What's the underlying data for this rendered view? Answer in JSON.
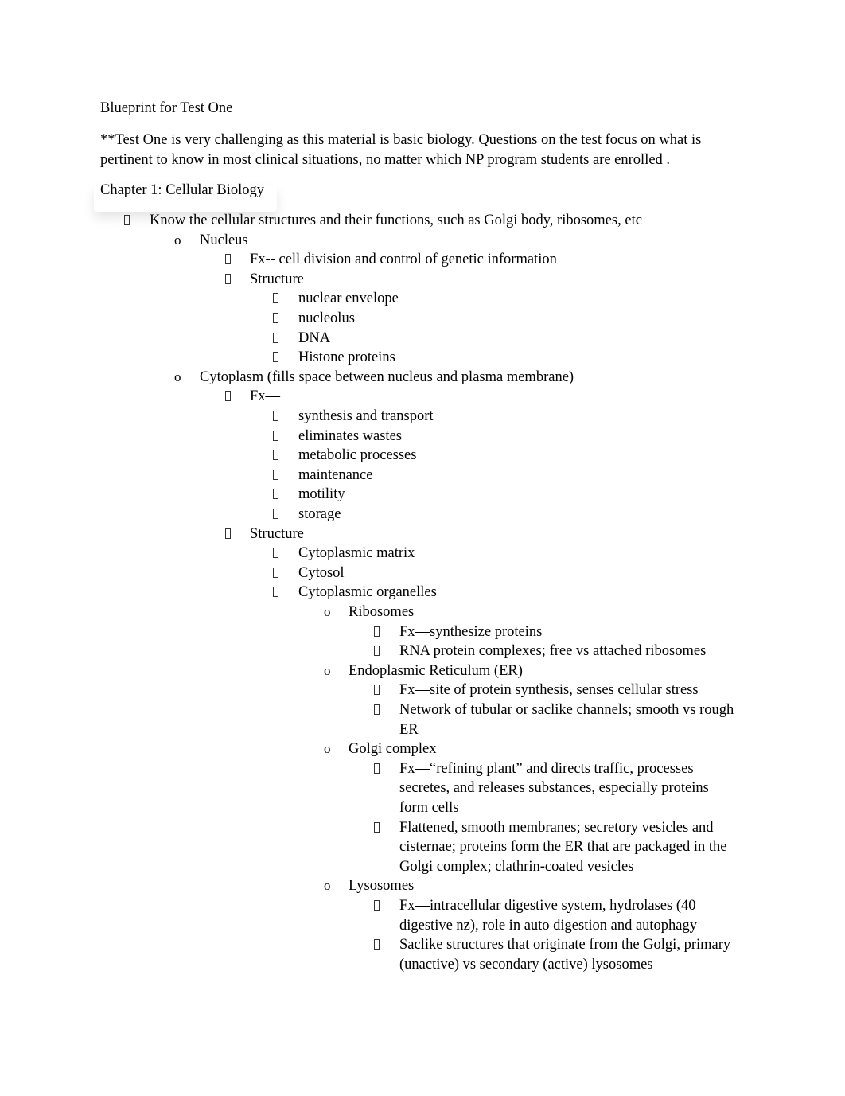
{
  "document": {
    "title": "Blueprint for Test One",
    "intro_line1": "**Test One is very challenging as this material is basic biology.  Questions on the test focus on what is",
    "intro_line2": "pertinent to know in most clinical situations, no matter which NP program students are enrolled  .",
    "chapter_heading": "Chapter 1: Cellular Biology",
    "bullet_glyphs": {
      "level1": "missing-glyph-box",
      "level2": "o",
      "level3": "missing-glyph-box",
      "level4": "missing-glyph-box"
    },
    "lines": [
      {
        "level": 1,
        "text": "Know the cellular structures and their functions, such as Golgi body, ribosomes, etc"
      },
      {
        "level": 2,
        "text": "Nucleus"
      },
      {
        "level": 3,
        "text": "Fx-- cell division and control of genetic information"
      },
      {
        "level": 3,
        "text": "Structure"
      },
      {
        "level": 4,
        "text": "nuclear envelope"
      },
      {
        "level": 4,
        "text": "nucleolus"
      },
      {
        "level": 4,
        "text": "DNA"
      },
      {
        "level": 4,
        "text": "Histone proteins"
      },
      {
        "level": 2,
        "text": "Cytoplasm (fills space between nucleus and plasma membrane)"
      },
      {
        "level": 3,
        "text": "Fx—"
      },
      {
        "level": 4,
        "text": "synthesis and transport"
      },
      {
        "level": 4,
        "text": "eliminates wastes"
      },
      {
        "level": 4,
        "text": "metabolic processes"
      },
      {
        "level": 4,
        "text": "maintenance"
      },
      {
        "level": 4,
        "text": "motility"
      },
      {
        "level": 4,
        "text": "storage"
      },
      {
        "level": 3,
        "text": "Structure"
      },
      {
        "level": 4,
        "text": "Cytoplasmic matrix"
      },
      {
        "level": 4,
        "text": "Cytosol"
      },
      {
        "level": 4,
        "text": "Cytoplasmic organelles"
      },
      {
        "level": 5,
        "text": "Ribosomes"
      },
      {
        "level": 6,
        "text": "Fx—synthesize proteins"
      },
      {
        "level": 6,
        "text": "RNA protein complexes; free vs attached ribosomes"
      },
      {
        "level": 5,
        "text": "Endoplasmic Reticulum (ER)"
      },
      {
        "level": 6,
        "text": "Fx—site of protein synthesis, senses cellular stress"
      },
      {
        "level": 6,
        "text": "Network of tubular or saclike channels; smooth vs rough",
        "cont": [
          "ER"
        ]
      },
      {
        "level": 5,
        "text": "Golgi complex"
      },
      {
        "level": 6,
        "text": "Fx—“refining plant” and directs traffic, processes",
        "cont": [
          "secretes, and releases substances, especially proteins",
          "form cells"
        ]
      },
      {
        "level": 6,
        "text": "Flattened, smooth membranes; secretory vesicles and",
        "cont": [
          "cisternae; proteins form the ER that are packaged in the",
          "Golgi complex; clathrin-coated vesicles"
        ]
      },
      {
        "level": 5,
        "text": "Lysosomes"
      },
      {
        "level": 6,
        "text": "Fx—intracellular digestive system, hydrolases (40",
        "cont": [
          "digestive nz), role in auto digestion and autophagy"
        ]
      },
      {
        "level": 6,
        "text": "Saclike structures that originate from the Golgi, primary",
        "cont": [
          "(unactive) vs secondary (active) lysosomes"
        ]
      }
    ]
  }
}
